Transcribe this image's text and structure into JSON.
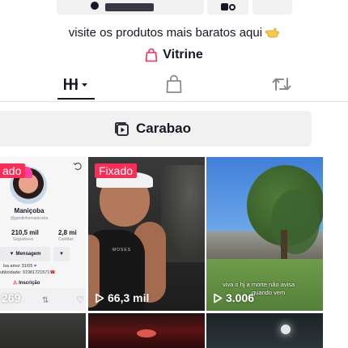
{
  "bio": {
    "text": "visite os produtos mais baratos  aqui",
    "emoji_icon": "pointing-hand-emoji"
  },
  "showcase": {
    "label": "Vitrine",
    "icon": "shopping-bag-icon",
    "color": "#fe2c55"
  },
  "tabs": [
    {
      "name": "videos-tab",
      "icon": "grid-icon",
      "active": true
    },
    {
      "name": "shop-tab",
      "icon": "bag-icon",
      "active": false
    },
    {
      "name": "reposts-tab",
      "icon": "repost-icon",
      "active": false
    }
  ],
  "playlist": {
    "label": "Carabao",
    "icon": "playlist-icon"
  },
  "videos": [
    {
      "badge": "ado",
      "views": "269",
      "profile": {
        "name": "Maniçoba",
        "handle": "@gordinhomanicoba",
        "followers": "210,5 mil",
        "followers_label": "Seguidores",
        "likes": "2,8 mi",
        "likes_label": "Curtidas",
        "message_button": "Mensagem",
        "bio_line1": "lsa amor 31/05",
        "bio_line2": "ublicidade: 91981721571",
        "subscribe": "Inscrição"
      }
    },
    {
      "badge": "Fixado",
      "views": "66,3 mil",
      "shirt_text": "MOSES"
    },
    {
      "badge": "",
      "views": "3.006",
      "caption_line1": "viva o hj a morte não avisa",
      "caption_line2": "quando vem"
    }
  ],
  "colors": {
    "accent": "#fe2c55",
    "text": "#161823",
    "muted_bg": "#f1f1f2"
  }
}
